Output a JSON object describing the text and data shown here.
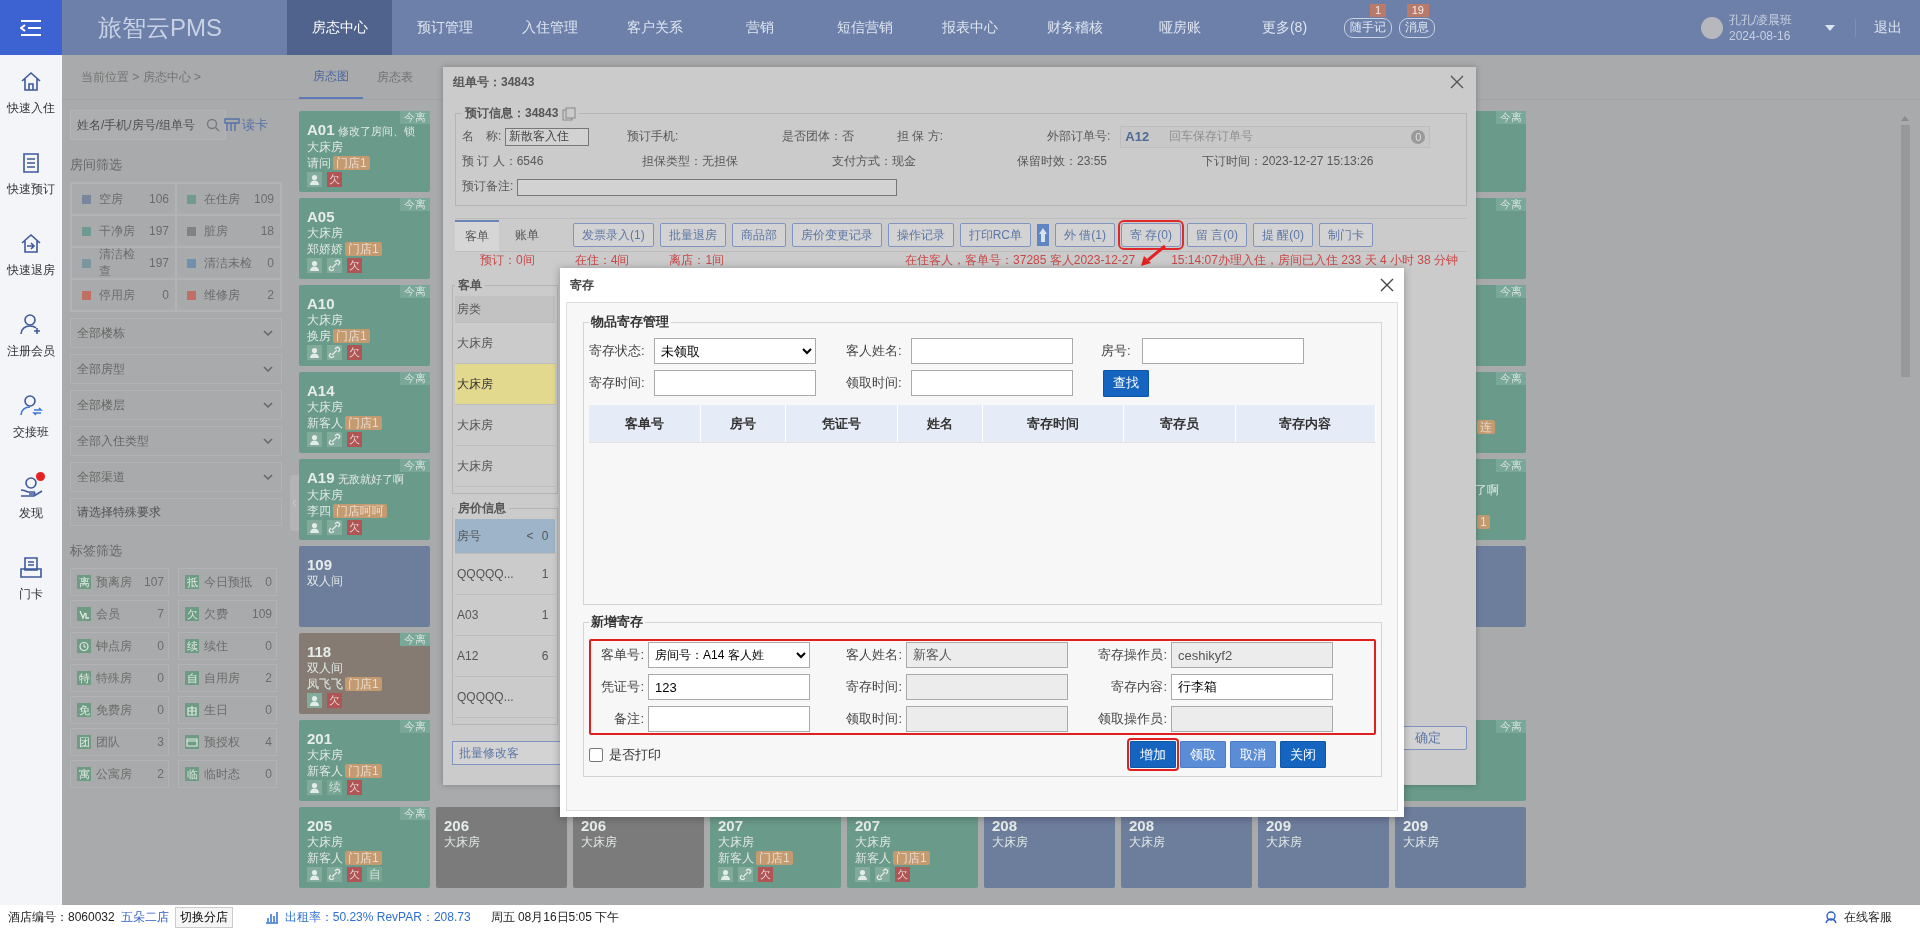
{
  "top_bar": {
    "logo": "旅智云PMS",
    "menu": [
      {
        "label": "房态中心",
        "selected": true
      },
      {
        "label": "预订管理",
        "selected": false
      },
      {
        "label": "入住管理",
        "selected": false
      },
      {
        "label": "客户关系",
        "selected": false
      },
      {
        "label": "营销",
        "selected": false
      },
      {
        "label": "短信营销",
        "selected": false
      },
      {
        "label": "报表中心",
        "selected": false
      },
      {
        "label": "财务稽核",
        "selected": false
      },
      {
        "label": "哑房账",
        "selected": false
      },
      {
        "label": "更多(8)",
        "selected": false
      }
    ],
    "quick_buttons": [
      {
        "label": "随手记",
        "count": "1"
      },
      {
        "label": "消息",
        "count": "19"
      }
    ],
    "user": {
      "name": "孔孔/凌晨班",
      "date": "2024-08-16"
    },
    "logout": "退出"
  },
  "side_nav": [
    {
      "kind": "checkin",
      "label": "快速入住",
      "alert": false
    },
    {
      "kind": "booking",
      "label": "快速预订",
      "alert": false
    },
    {
      "kind": "checkout",
      "label": "快速退房",
      "alert": false
    },
    {
      "kind": "member",
      "label": "注册会员",
      "alert": false
    },
    {
      "kind": "shift",
      "label": "交接班",
      "alert": false
    },
    {
      "kind": "discover",
      "label": "发现",
      "alert": true
    },
    {
      "kind": "card",
      "label": "门卡",
      "alert": false
    }
  ],
  "breadcrumb": "当前位置 > 房态中心 >",
  "view_tabs": [
    {
      "label": "房态图",
      "selected": true
    },
    {
      "label": "房态表",
      "selected": false
    }
  ],
  "filter_panel": {
    "search": {
      "placeholder": "姓名/手机/房号/组单号"
    },
    "read_card": "读卡",
    "room_filter_title": "房间筛选",
    "room_statuses": [
      {
        "name": "空房",
        "count": "106",
        "color": "#7a869e"
      },
      {
        "name": "在住房",
        "count": "109",
        "color": "#6f9c8c"
      },
      {
        "name": "干净房",
        "count": "197",
        "color": "#6f9a94"
      },
      {
        "name": "脏房",
        "count": "18",
        "color": "#828282"
      },
      {
        "name": "清洁检查",
        "count": "197",
        "color": "#7c96a0"
      },
      {
        "name": "清洁未检",
        "count": "0",
        "color": "#6f90b0"
      },
      {
        "name": "停用房",
        "count": "0",
        "color": "#c07062"
      },
      {
        "name": "维修房",
        "count": "2",
        "color": "#c07062"
      }
    ],
    "dropdowns": [
      "全部楼栋",
      "全部房型",
      "全部楼层",
      "全部入住类型",
      "全部渠道"
    ],
    "special_request": {
      "placeholder": "请选择特殊要求"
    },
    "tag_filter_title": "标签筛选",
    "tags": [
      {
        "kind": "glyph",
        "glyph": "离",
        "name": "预离房",
        "count": "107"
      },
      {
        "kind": "glyph",
        "glyph": "抵",
        "name": "今日预抵",
        "count": "0"
      },
      {
        "kind": "member",
        "name": "会员",
        "count": "7"
      },
      {
        "kind": "glyph",
        "glyph": "欠",
        "name": "欠费",
        "count": "109"
      },
      {
        "kind": "clock",
        "name": "钟点房",
        "count": "0"
      },
      {
        "kind": "glyph",
        "glyph": "续",
        "name": "续住",
        "count": "0"
      },
      {
        "kind": "glyph",
        "glyph": "特",
        "name": "特殊房",
        "count": "0"
      },
      {
        "kind": "glyph",
        "glyph": "自",
        "name": "自用房",
        "count": "2"
      },
      {
        "kind": "glyph",
        "glyph": "免",
        "name": "免费房",
        "count": "0"
      },
      {
        "kind": "gift",
        "name": "生日",
        "count": "0"
      },
      {
        "kind": "glyph",
        "glyph": "团",
        "name": "团队",
        "count": "3"
      },
      {
        "kind": "card",
        "name": "预授权",
        "count": "4"
      },
      {
        "kind": "glyph",
        "glyph": "寓",
        "name": "公寓房",
        "count": "2"
      },
      {
        "kind": "glyph",
        "glyph": "临",
        "name": "临时态",
        "count": "0"
      }
    ]
  },
  "rooms": {
    "left_column": [
      {
        "kind": "occupied",
        "number": "A01",
        "note": "修改了房间、锁",
        "type": "大床房",
        "guest": "请问",
        "tag": "门店1",
        "badge": "今离",
        "markers": [
          {
            "kind": "guest"
          },
          {
            "kind": "debt",
            "text": "欠"
          }
        ]
      },
      {
        "kind": "occupied",
        "number": "A05",
        "type": "大床房",
        "guest": "郑娇娇",
        "tag": "门店1",
        "badge": "今离",
        "markers": [
          {
            "kind": "guest"
          },
          {
            "kind": "link"
          },
          {
            "kind": "debt",
            "text": "欠"
          }
        ]
      },
      {
        "kind": "occupied",
        "number": "A10",
        "type": "大床房",
        "guest": "换房",
        "tag": "门店1",
        "badge": "今离",
        "markers": [
          {
            "kind": "guest"
          },
          {
            "kind": "link"
          },
          {
            "kind": "debt",
            "text": "欠"
          }
        ]
      },
      {
        "kind": "occupied",
        "number": "A14",
        "type": "大床房",
        "guest": "新客人",
        "tag": "门店1",
        "badge": "今离",
        "markers": [
          {
            "kind": "guest"
          },
          {
            "kind": "link"
          },
          {
            "kind": "debt",
            "text": "欠"
          }
        ]
      },
      {
        "kind": "occupied",
        "number": "A19",
        "note": "无敌就好了啊",
        "type": "大床房",
        "guest": "李四",
        "tag": "门店呵呵",
        "badge": "今离",
        "markers": [
          {
            "kind": "guest"
          },
          {
            "kind": "link"
          },
          {
            "kind": "debt",
            "text": "欠"
          }
        ]
      },
      {
        "kind": "vacant",
        "number": "109",
        "type": "双人间"
      },
      {
        "kind": "reserved",
        "number": "118",
        "type": "双人间",
        "guest": "凤飞飞",
        "tag": "门店1",
        "badge": "今离",
        "markers": [
          {
            "kind": "guest"
          },
          {
            "kind": "debt",
            "text": "欠"
          }
        ]
      },
      {
        "kind": "occupied",
        "number": "201",
        "type": "大床房",
        "guest": "新客人",
        "tag": "门店1",
        "badge": "今离",
        "markers": [
          {
            "kind": "guest"
          },
          {
            "kind": "label",
            "text": "续"
          },
          {
            "kind": "debt",
            "text": "欠"
          }
        ]
      },
      {
        "kind": "occupied",
        "number": "205",
        "type": "大床房",
        "guest": "新客人",
        "tag": "门店1",
        "badge": "今离",
        "markers": [
          {
            "kind": "guest"
          },
          {
            "kind": "link"
          },
          {
            "kind": "debt",
            "text": "欠"
          },
          {
            "kind": "label",
            "text": "自"
          }
        ]
      }
    ],
    "right_column": [
      {
        "kind": "occupied",
        "badge": "今离"
      },
      {
        "kind": "occupied",
        "badge": "今离"
      },
      {
        "kind": "occupied",
        "badge": "今离"
      },
      {
        "kind": "occupied",
        "badge": "今离",
        "tag_fragment": "连"
      },
      {
        "kind": "occupied",
        "badge": "今离",
        "note_fragment": "了啊",
        "tag_fragment": "1"
      },
      {
        "kind": "vacant"
      },
      {
        "kind": "empty"
      },
      {
        "kind": "occupied",
        "badge": "今离"
      }
    ],
    "bottom_row": [
      {
        "kind": "dirty",
        "number": "206",
        "type": "大床房"
      },
      {
        "kind": "dirty",
        "number": "206",
        "type": "大床房"
      },
      {
        "kind": "occupied",
        "number": "207",
        "type": "大床房",
        "guest": "新客人",
        "tag": "门店1",
        "markers": [
          {
            "kind": "guest"
          },
          {
            "kind": "link"
          },
          {
            "kind": "debt",
            "text": "欠"
          }
        ]
      },
      {
        "kind": "occupied",
        "number": "207",
        "type": "大床房",
        "guest": "新客人",
        "tag": "门店1",
        "markers": [
          {
            "kind": "guest"
          },
          {
            "kind": "link"
          },
          {
            "kind": "debt",
            "text": "欠"
          }
        ]
      },
      {
        "kind": "vacant",
        "number": "208",
        "type": "大床房"
      },
      {
        "kind": "vacant",
        "number": "208",
        "type": "大床房"
      },
      {
        "kind": "vacant",
        "number": "209",
        "type": "大床房"
      },
      {
        "kind": "vacant",
        "number": "209",
        "type": "大床房"
      }
    ]
  },
  "order_dialog": {
    "title": "组单号：34843",
    "booking_legend": "预订信息：34843",
    "booking_rows": [
      [
        {
          "kind": "field",
          "label": "名　称:",
          "value": "新散客入住"
        },
        {
          "kind": "text",
          "label": "预订手机:"
        },
        {
          "kind": "text",
          "label": "是否团体：否"
        },
        {
          "kind": "text",
          "label": "担 保 方:"
        },
        {
          "kind": "external",
          "label": "外部订单号:",
          "value": "A12",
          "placeholder": "回车保存订单号",
          "count": "0"
        }
      ],
      [
        {
          "kind": "text",
          "label": "预 订 人：6546"
        },
        {
          "kind": "text",
          "label": "担保类型：无担保"
        },
        {
          "kind": "text",
          "label": "支付方式：现金"
        },
        {
          "kind": "text",
          "label": "保留时效：23:55"
        },
        {
          "kind": "text",
          "label": "下订时间：2023-12-27 15:13:26"
        }
      ],
      [
        {
          "kind": "note",
          "label": "预订备注:"
        }
      ]
    ],
    "tabs": [
      {
        "label": "客单",
        "selected": true
      },
      {
        "label": "账单",
        "selected": false
      }
    ],
    "actions": [
      {
        "kind": "button",
        "label": "发票录入(1)",
        "highlighted": false
      },
      {
        "kind": "button",
        "label": "批量退房",
        "highlighted": false
      },
      {
        "kind": "button",
        "label": "商品部",
        "highlighted": false
      },
      {
        "kind": "button",
        "label": "房价变更记录",
        "highlighted": false
      },
      {
        "kind": "button",
        "label": "操作记录",
        "highlighted": false
      },
      {
        "kind": "button",
        "label": "打印RC单",
        "highlighted": false
      },
      {
        "kind": "upload"
      },
      {
        "kind": "button",
        "label": "外 借(1)",
        "highlighted": false
      },
      {
        "kind": "button",
        "label": "寄 存(0)",
        "highlighted": true
      },
      {
        "kind": "button",
        "label": "留 言(0)",
        "highlighted": false
      },
      {
        "kind": "button",
        "label": "提 醒(0)",
        "highlighted": false
      },
      {
        "kind": "button",
        "label": "制门卡",
        "highlighted": false
      }
    ],
    "summary": [
      "预订：0间",
      "在住：4间",
      "离店：1间"
    ],
    "guest_info": [
      "在住客人，客单号：37285 客人2023-12-27",
      "15:14:07办理入住，房间已入住 233 天 4 小时 38 分钟"
    ],
    "order_panel": {
      "legend": "客单",
      "column": "房类",
      "rows": [
        {
          "text": "大床房",
          "selected": false
        },
        {
          "text": "大床房",
          "selected": true
        },
        {
          "text": "大床房",
          "selected": false
        },
        {
          "text": "大床房",
          "selected": false
        }
      ]
    },
    "rate_panel": {
      "legend": "房价信息",
      "columns": [
        "房号",
        "<",
        "0"
      ],
      "rows": [
        {
          "room": "QQQQQ...",
          "rate": "1"
        },
        {
          "room": "A03",
          "rate": "1"
        },
        {
          "room": "A12",
          "rate": "6"
        },
        {
          "room": "QQQQQ..."
        }
      ]
    },
    "batch_button": "批量修改客",
    "confirm_button": "确定"
  },
  "deposit_dialog": {
    "title": "寄存",
    "manage_legend": "物品寄存管理",
    "status_label": "寄存状态:",
    "status_value": "未领取",
    "guest_label": "客人姓名:",
    "room_label": "房号:",
    "deposit_time_label": "寄存时间:",
    "pickup_time_label": "领取时间:",
    "search_button": "查找",
    "columns": [
      "客单号",
      "房号",
      "凭证号",
      "姓名",
      "寄存时间",
      "寄存员",
      "寄存内容"
    ],
    "new_legend": "新增寄存",
    "new_fields": [
      {
        "kind": "select",
        "label": "客单号:",
        "value": "房间号：A14 客人姓"
      },
      {
        "kind": "readonly",
        "label": "客人姓名:",
        "value": "新客人"
      },
      {
        "kind": "readonly",
        "label": "寄存操作员:",
        "value": "ceshikyf2"
      },
      {
        "kind": "input",
        "label": "凭证号:",
        "value": "123"
      },
      {
        "kind": "readonly",
        "label": "寄存时间:"
      },
      {
        "kind": "input",
        "label": "寄存内容:",
        "value": "行李箱"
      },
      {
        "kind": "input",
        "label": "备注:"
      },
      {
        "kind": "readonly",
        "label": "领取时间:"
      },
      {
        "kind": "readonly",
        "label": "领取操作员:"
      }
    ],
    "print": {
      "label": "是否打印",
      "checked": false
    },
    "buttons": [
      {
        "label": "增加",
        "kind": "primary",
        "highlighted": true
      },
      {
        "label": "领取",
        "kind": "light",
        "highlighted": false
      },
      {
        "label": "取消",
        "kind": "light",
        "highlighted": false
      },
      {
        "label": "关闭",
        "kind": "primary",
        "highlighted": false
      }
    ]
  },
  "status_bar": {
    "hotel": "酒店编号：8060032",
    "branch": "五朵二店",
    "switch": "切换分店",
    "occupancy": "出租率：50.23% RevPAR：208.73",
    "datetime": "周五 08月16日5:05 下午",
    "support": "在线客服"
  }
}
